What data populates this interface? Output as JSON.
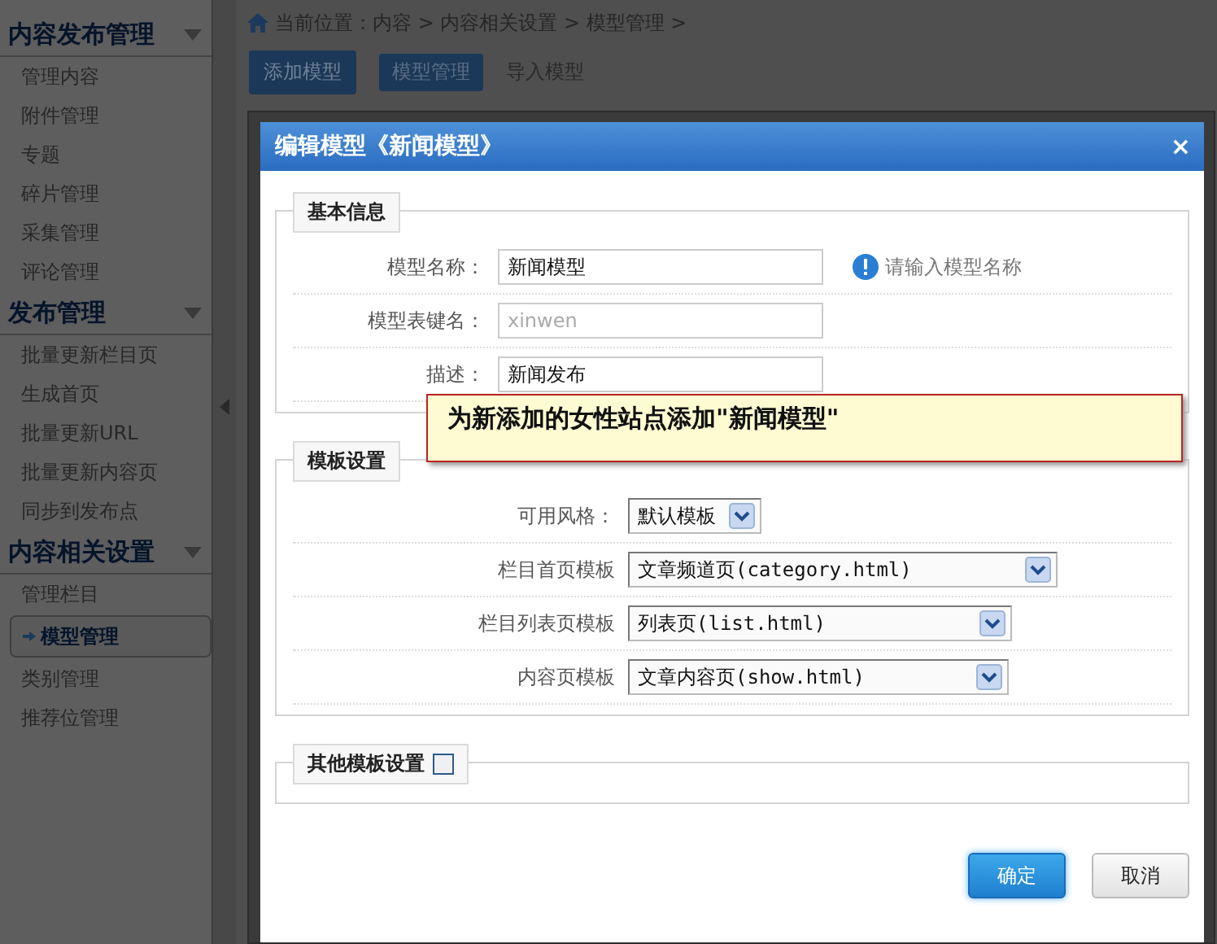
{
  "sidebar": {
    "groups": [
      {
        "title": "内容发布管理",
        "items": [
          {
            "label": "管理内容",
            "selected": false
          },
          {
            "label": "附件管理",
            "selected": false
          },
          {
            "label": "专题",
            "selected": false
          },
          {
            "label": "碎片管理",
            "selected": false
          },
          {
            "label": "采集管理",
            "selected": false
          },
          {
            "label": "评论管理",
            "selected": false
          }
        ]
      },
      {
        "title": "发布管理",
        "items": [
          {
            "label": "批量更新栏目页",
            "selected": false
          },
          {
            "label": "生成首页",
            "selected": false
          },
          {
            "label": "批量更新URL",
            "selected": false
          },
          {
            "label": "批量更新内容页",
            "selected": false
          },
          {
            "label": "同步到发布点",
            "selected": false
          }
        ]
      },
      {
        "title": "内容相关设置",
        "items": [
          {
            "label": "管理栏目",
            "selected": false
          },
          {
            "label": "模型管理",
            "selected": true
          },
          {
            "label": "类别管理",
            "selected": false
          },
          {
            "label": "推荐位管理",
            "selected": false
          }
        ]
      }
    ]
  },
  "breadcrumb": "当前位置：内容 > 内容相关设置 > 模型管理 >",
  "tabs": [
    {
      "label": "添加模型",
      "selected": true,
      "kind": "boxed"
    },
    {
      "label": "模型管理",
      "selected": false,
      "kind": "boxed"
    },
    {
      "label": "导入模型",
      "selected": false,
      "kind": "plain"
    }
  ],
  "dialog": {
    "title": "编辑模型《新闻模型》",
    "close": "×",
    "sections": [
      {
        "legend": "基本信息",
        "rows": [
          {
            "label": "模型名称：",
            "kind": "input",
            "value": "新闻模型",
            "disabled": false,
            "hint": "请输入模型名称"
          },
          {
            "label": "模型表键名：",
            "kind": "input",
            "value": "xinwen",
            "disabled": true
          },
          {
            "label": "描述：",
            "kind": "input",
            "value": "新闻发布",
            "disabled": false
          }
        ]
      },
      {
        "legend": "模板设置",
        "rows": [
          {
            "label": "可用风格：",
            "kind": "select",
            "value": "默认模板"
          },
          {
            "label": "栏目首页模板",
            "kind": "select",
            "value": "文章频道页(category.html)"
          },
          {
            "label": "栏目列表页模板",
            "kind": "select",
            "value": "列表页(list.html)"
          },
          {
            "label": "内容页模板",
            "kind": "select",
            "value": "文章内容页(show.html)"
          }
        ]
      },
      {
        "legend": "其他模板设置",
        "checkbox": {
          "checked": false
        }
      }
    ],
    "buttons": [
      {
        "label": "确定",
        "primary": true
      },
      {
        "label": "取消",
        "primary": false
      }
    ]
  },
  "callout": "为新添加的女性站点添加\"新闻模型\""
}
